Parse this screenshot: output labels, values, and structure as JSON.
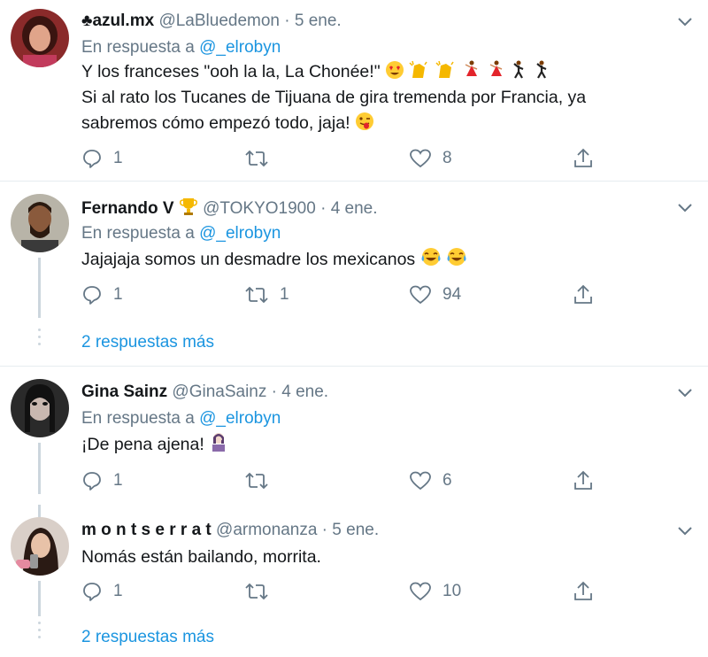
{
  "tweets": [
    {
      "name": "azul.mx",
      "name_prefix_icon": "club-suit-icon",
      "handle": "@LaBluedemon",
      "date": "5 ene.",
      "reply_prefix": "En respuesta a",
      "reply_to": "@_elrobyn",
      "lines": [
        "Y los franceses \"ooh la la, La Chonée!\"",
        "Si al rato los Tucanes de Tijuana de gira tremenda por Francia, ya",
        "sabremos cómo empezó todo, jaja!"
      ],
      "replies": "1",
      "retweets": "",
      "likes": "8"
    },
    {
      "name": "Fernando V",
      "name_suffix_icon": "trophy-icon",
      "handle": "@TOKYO1900",
      "date": "4 ene.",
      "reply_prefix": "En respuesta a",
      "reply_to": "@_elrobyn",
      "lines": [
        "Jajajaja somos un desmadre los mexicanos"
      ],
      "replies": "1",
      "retweets": "1",
      "likes": "94",
      "more_replies": "2 respuestas más"
    },
    {
      "name": "Gina Sainz",
      "handle": "@GinaSainz",
      "date": "4 ene.",
      "reply_prefix": "En respuesta a",
      "reply_to": "@_elrobyn",
      "lines": [
        "¡De pena ajena!"
      ],
      "replies": "1",
      "retweets": "",
      "likes": "6"
    },
    {
      "name": "m o n t s e r r a t",
      "handle": "@armonanza",
      "date": "5 ene.",
      "lines": [
        "Nomás están bailando, morrita."
      ],
      "replies": "1",
      "retweets": "",
      "likes": "10",
      "more_replies": "2 respuestas más"
    }
  ],
  "colors": {
    "link": "#1b95e0",
    "muted": "#657786",
    "divider": "#e6ecf0",
    "thread": "#ccd6dd"
  }
}
